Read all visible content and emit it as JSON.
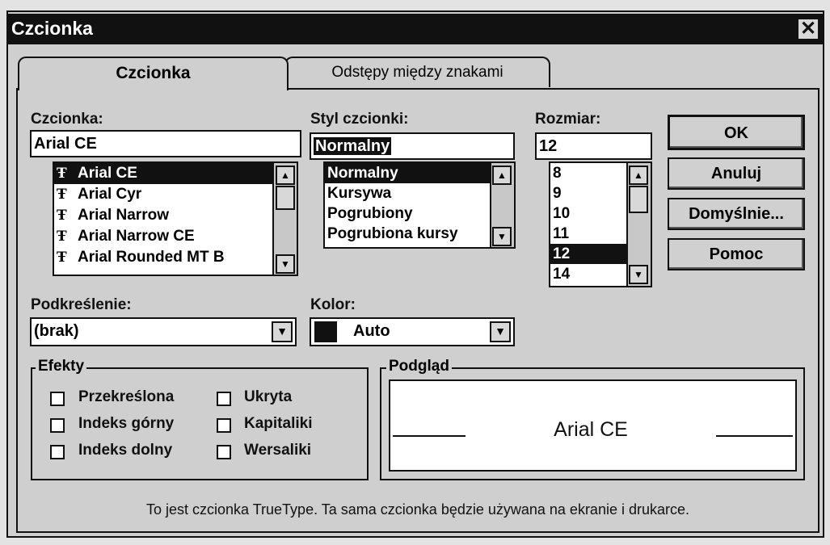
{
  "window": {
    "title": "Czcionka",
    "close_glyph": "✕"
  },
  "tabs": [
    {
      "label": "Czcionka",
      "active": true
    },
    {
      "label": "Odstępy między znakami",
      "active": false
    }
  ],
  "font": {
    "label": "Czcionka:",
    "value": "Arial CE",
    "items": [
      "Arial CE",
      "Arial Cyr",
      "Arial Narrow",
      "Arial Narrow CE",
      "Arial Rounded MT B"
    ],
    "selected_index": 0
  },
  "style": {
    "label": "Styl czcionki:",
    "value": "Normalny",
    "items": [
      "Normalny",
      "Kursywa",
      "Pogrubiony",
      "Pogrubiona kursy"
    ],
    "selected_index": 0
  },
  "size": {
    "label": "Rozmiar:",
    "value": "12",
    "items": [
      "8",
      "9",
      "10",
      "11",
      "12",
      "14"
    ],
    "selected_index": 4
  },
  "buttons": {
    "ok": "OK",
    "cancel": "Anuluj",
    "default": "Domyślnie...",
    "help": "Pomoc"
  },
  "underline": {
    "label": "Podkreślenie:",
    "value": "(brak)"
  },
  "color": {
    "label": "Kolor:",
    "value": "Auto",
    "swatch": "#111111"
  },
  "effects": {
    "legend": "Efekty",
    "items": [
      "Przekreślona",
      "Ukryta",
      "Indeks górny",
      "Kapitaliki",
      "Indeks dolny",
      "Wersaliki"
    ],
    "checked": [
      false,
      false,
      false,
      false,
      false,
      false
    ]
  },
  "preview": {
    "legend": "Podgląd",
    "text": "Arial CE"
  },
  "footer": "To jest czcionka TrueType. Ta sama czcionka będzie używana na ekranie i drukarce.",
  "icons": {
    "truetype": "truetype-icon",
    "up": "▲",
    "down": "▼"
  }
}
